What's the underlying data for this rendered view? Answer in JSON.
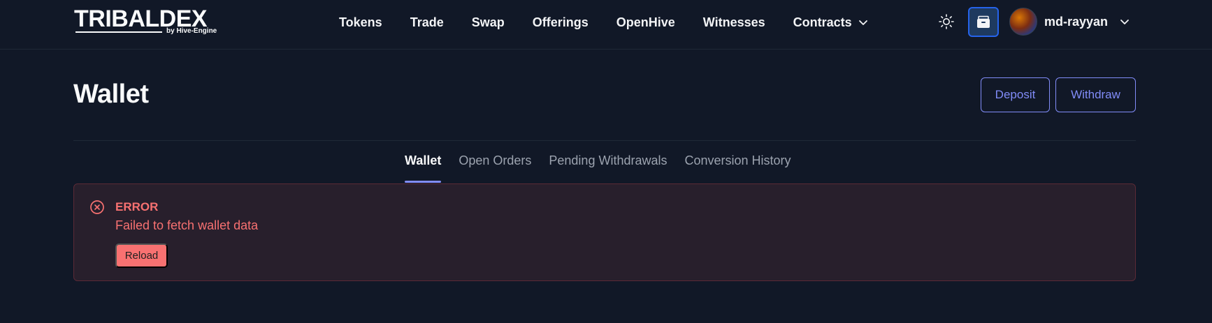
{
  "brand": {
    "name": "TRIBALDEX",
    "tagline": "by Hive-Engine"
  },
  "nav": {
    "items": [
      {
        "label": "Tokens"
      },
      {
        "label": "Trade"
      },
      {
        "label": "Swap"
      },
      {
        "label": "Offerings"
      },
      {
        "label": "OpenHive"
      },
      {
        "label": "Witnesses"
      },
      {
        "label": "Contracts",
        "has_dropdown": true,
        "icon": "chevron-down-icon"
      }
    ]
  },
  "header_actions": {
    "theme_icon": "sun-icon",
    "wallet_icon": "wallet-icon",
    "username": "md-rayyan",
    "user_icon": "chevron-down-icon"
  },
  "page": {
    "title": "Wallet",
    "deposit_label": "Deposit",
    "withdraw_label": "Withdraw"
  },
  "tabs": [
    {
      "label": "Wallet",
      "active": true
    },
    {
      "label": "Open Orders",
      "active": false
    },
    {
      "label": "Pending Withdrawals",
      "active": false
    },
    {
      "label": "Conversion History",
      "active": false
    }
  ],
  "error": {
    "icon": "error-x-circle-icon",
    "title": "ERROR",
    "message": "Failed to fetch wallet data",
    "reload_label": "Reload"
  },
  "colors": {
    "background": "#111827",
    "accent": "#818cf8",
    "error": "#f87171",
    "wallet_button_border": "#2563eb"
  }
}
